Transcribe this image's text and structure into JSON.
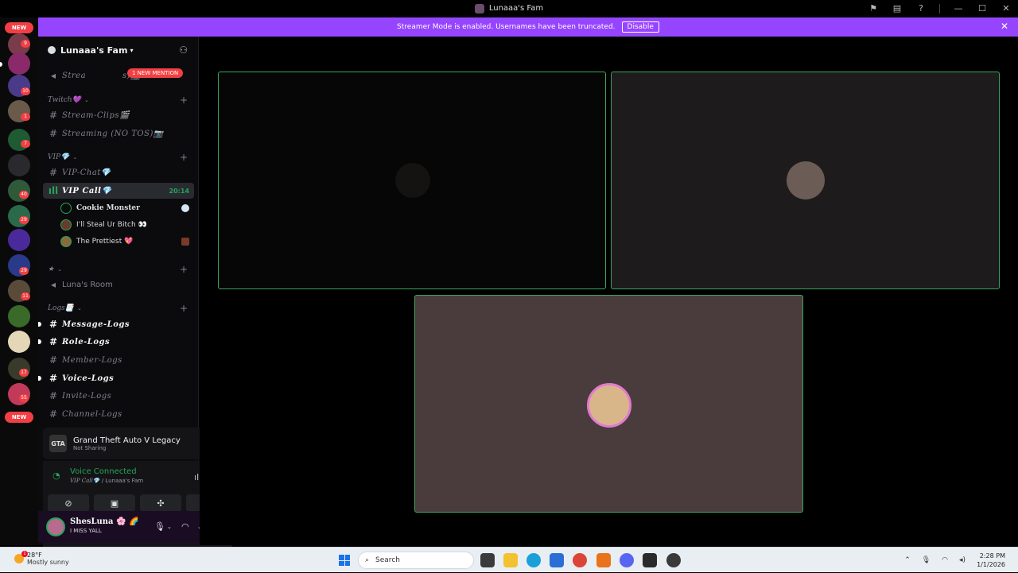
{
  "window": {
    "title": "Lunaaa's Fam"
  },
  "banner": {
    "text": "Streamer Mode is enabled. Usernames have been truncated.",
    "button": "Disable"
  },
  "rail": {
    "top_new": "NEW",
    "bottom_new": "NEW",
    "badges": [
      "9",
      "1",
      "10",
      "1",
      "7",
      "40",
      "29",
      "29",
      "11",
      "17",
      "55"
    ]
  },
  "guild": {
    "name": "Lunaaa's Fam"
  },
  "mention_pill": "1 NEW MENTION",
  "channels": {
    "stream_top": "Strea",
    "stream_top_tail": "s)📷",
    "twitch_cat": "Twitch💜",
    "stream_clips": "Stream-Clips🎬",
    "streaming": "Streaming (NO TOS)📷",
    "vip_cat": "VIP💎",
    "vip_chat": "VIP-Chat💎",
    "vip_call": "VIP Call💎",
    "vip_call_timer": "20:14",
    "star_cat": "★",
    "lunas_room": "Luna's Room",
    "logs_cat": "Logs📑",
    "message_logs": "Message-Logs",
    "role_logs": "Role-Logs",
    "member_logs": "Member-Logs",
    "voice_logs": "Voice-Logs",
    "invite_logs": "Invite-Logs",
    "channel_logs": "Channel-Logs"
  },
  "voice_users": [
    {
      "name": "Cookie Monster"
    },
    {
      "name": "I'll Steal Ur Bitch 👀"
    },
    {
      "name": "The Prettiest 💖"
    }
  ],
  "activity": {
    "game": "Grand Theft Auto V Legacy",
    "status": "Not Sharing",
    "icon_text": "GTA"
  },
  "voice": {
    "status": "Voice Connected",
    "channel": "VIP Call💎",
    "server": " / Lunaaa's Fam"
  },
  "user": {
    "name": "ShesLuna 🌸 🌈",
    "status": "I MISS YALL"
  },
  "taskbar": {
    "temp": "28°F",
    "weather": "Mostly sunny",
    "weather_badge": "1",
    "search": "Search",
    "time": "2:28 PM",
    "date": "1/1/2026"
  },
  "colors": {
    "accent_banner": "#9645ff",
    "speaking_border": "#3ba55d",
    "mention_red": "#f23f43",
    "voice_green": "#23a55a"
  }
}
